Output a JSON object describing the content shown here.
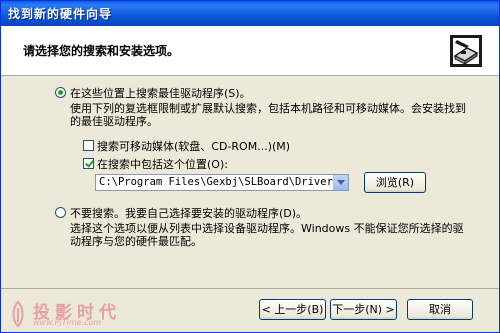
{
  "window": {
    "title": "找到新的硬件向导"
  },
  "header": {
    "text": "请选择您的搜索和安装选项。",
    "icon": "hardware-wizard-icon"
  },
  "options": {
    "search_best": {
      "label": "在这些位置上搜索最佳驱动程序(S)。",
      "selected": true,
      "description": "使用下列的复选框限制或扩展默认搜索，包括本机路径和可移动媒体。会安装找到的最佳驱动程序。"
    },
    "removable": {
      "label": "搜索可移动媒体(软盘、CD-ROM...)(M)",
      "checked": false
    },
    "include_location": {
      "label": "在搜索中包括这个位置(O):",
      "checked": true
    },
    "path": {
      "value": "C:\\Program Files\\Gexbj\\SLBoard\\Driver"
    },
    "browse_label": "浏览(R)",
    "dont_search": {
      "label": "不要搜索。我要自己选择要安装的驱动程序(D)。",
      "selected": false,
      "description": "选择这个选项以便从列表中选择设备驱动程序。Windows 不能保证您所选择的驱动程序与您的硬件最匹配。"
    }
  },
  "buttons": {
    "back": "< 上一步(B)",
    "next": "下一步(N) >",
    "cancel": "取消"
  },
  "watermark": {
    "text": "投影时代",
    "url": "www.PjTime.com"
  },
  "colors": {
    "title_blue": "#0a5ce8",
    "check_green": "#21a121"
  }
}
